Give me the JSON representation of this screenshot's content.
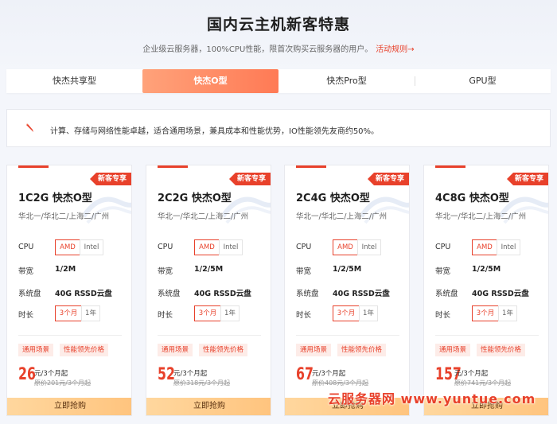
{
  "header": {
    "title": "国内云主机新客特惠",
    "subtitle": "企业级云服务器，100%CPU性能，限首次购买云服务器的用户。",
    "rule_link": "活动规则→"
  },
  "tabs": [
    {
      "label": "快杰共享型",
      "active": false
    },
    {
      "label": "快杰O型",
      "active": true
    },
    {
      "label": "快杰Pro型",
      "active": false
    },
    {
      "label": "GPU型",
      "active": false
    }
  ],
  "description": {
    "icon": "pen-icon",
    "text": "计算、存储与网络性能卓越，适合通用场景，兼具成本和性能优势，IO性能领先友商约50%。"
  },
  "labels": {
    "cpu": "CPU",
    "bandwidth": "带宽",
    "disk": "系统盘",
    "duration": "时长",
    "buy": "立即抢购",
    "badge": "新客专享",
    "tag_scene": "通用场景",
    "tag_price": "性能领先价格",
    "cpu_amd": "AMD",
    "cpu_intel": "Intel",
    "dur_3m": "3个月",
    "dur_1y": "1年",
    "price_unit": "元/3个月起"
  },
  "cards": [
    {
      "name": "1C2G 快杰O型",
      "regions": "华北一/华北二/上海二/广州",
      "bandwidth": "1/2M",
      "disk": "40G RSSD云盘",
      "price": "26",
      "original": "原价201元/3个月起"
    },
    {
      "name": "2C2G 快杰O型",
      "regions": "华北一/华北二/上海二/广州",
      "bandwidth": "1/2/5M",
      "disk": "40G RSSD云盘",
      "price": "52",
      "original": "原价318元/3个月起"
    },
    {
      "name": "2C4G 快杰O型",
      "regions": "华北一/华北二/上海二/广州",
      "bandwidth": "1/2/5M",
      "disk": "40G RSSD云盘",
      "price": "67",
      "original": "原价408元/3个月起"
    },
    {
      "name": "4C8G 快杰O型",
      "regions": "华北一/华北二/上海二/广州",
      "bandwidth": "1/2/5M",
      "disk": "40G RSSD云盘",
      "price": "157",
      "original": "原价741元/3个月起"
    }
  ],
  "watermark": "云服务器网 www.yuntue.com",
  "colors": {
    "accent": "#e8412b",
    "tab_active": "#ff8a63",
    "buy_bg": "#ffc88a"
  }
}
